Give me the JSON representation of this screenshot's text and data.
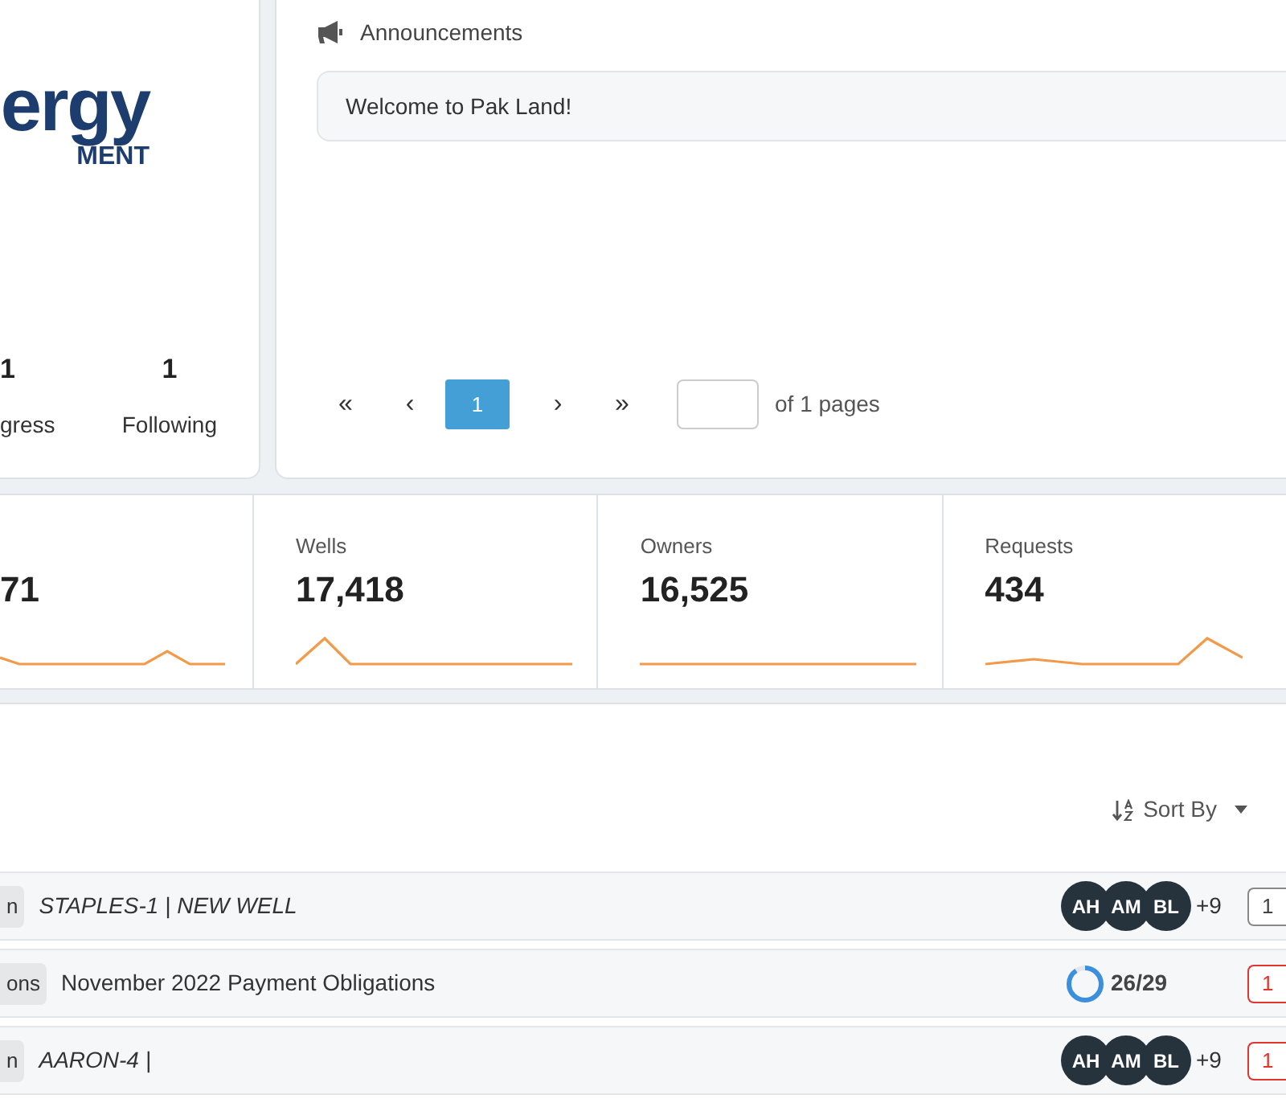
{
  "profile": {
    "logo_line_1": "ergy",
    "logo_line_2": "MENT",
    "stats": [
      {
        "value": "1",
        "label": "gress"
      },
      {
        "value": "1",
        "label": "Following"
      }
    ]
  },
  "announcements": {
    "title": "Announcements",
    "items": [
      "Welcome to Pak Land!"
    ],
    "pagination": {
      "first": "«",
      "prev": "‹",
      "pages": [
        {
          "label": "1",
          "selected": true
        }
      ],
      "next": "›",
      "last": "»",
      "page_of": "of 1 pages"
    }
  },
  "stat_cards": [
    {
      "value": "71"
    },
    {
      "label": "Wells",
      "value": "17,418"
    },
    {
      "label": "Owners",
      "value": "16,525"
    },
    {
      "label": "Requests",
      "value": "434"
    }
  ],
  "list": {
    "sort": "Sort By",
    "rows": [
      {
        "kind": "well",
        "tag": "n",
        "title": "STAPLES-1 | NEW WELL",
        "avatars": [
          "AH",
          "AM",
          "BL"
        ],
        "more": "+9",
        "badge": {
          "text": "1",
          "overdue": false
        }
      },
      {
        "kind": "obligation",
        "tag": "ons",
        "title": "November 2022 Payment Obligations",
        "level": 0.9,
        "progress": "26/29",
        "badge": {
          "text": "1",
          "overdue": true
        }
      },
      {
        "kind": "well",
        "tag": "n",
        "title": "AARON-4 |",
        "avatars": [
          "AH",
          "AM",
          "BL"
        ],
        "more": "+9",
        "badge": {
          "text": "1",
          "overdue": true
        }
      }
    ]
  }
}
